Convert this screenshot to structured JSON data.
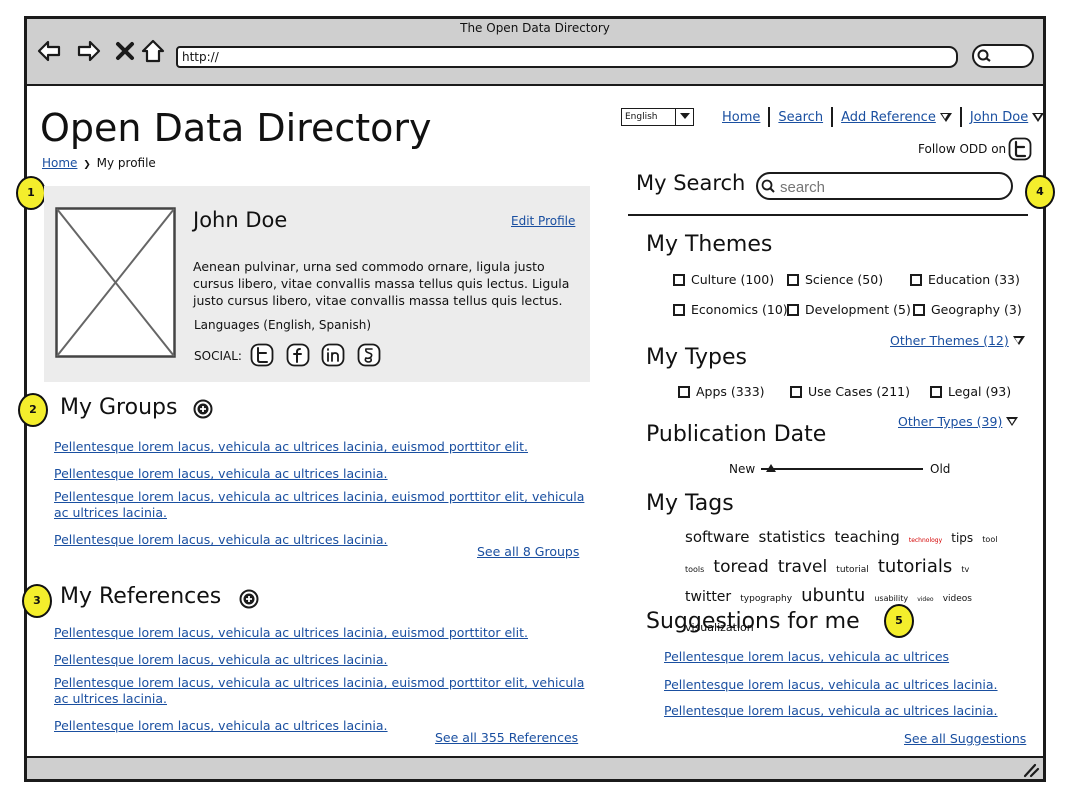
{
  "window": {
    "title": "The Open Data Directory",
    "url": "http://"
  },
  "header": {
    "title": "Open Data Directory",
    "breadcrumb": {
      "home": "Home",
      "separator": "❯",
      "current": "My profile"
    }
  },
  "top_nav": {
    "language": "English",
    "home": "Home",
    "search": "Search",
    "add_reference": "Add Reference",
    "user": "John Doe",
    "follow_label": "Follow ODD on"
  },
  "markers": [
    "1",
    "2",
    "3",
    "4",
    "5"
  ],
  "profile": {
    "name": "John Doe",
    "edit_label": "Edit Profile",
    "bio": "Aenean pulvinar, urna sed commodo ornare, ligula justo cursus libero, vitae convallis massa tellus quis lectus. Ligula justo cursus libero, vitae convallis massa tellus quis lectus.",
    "languages": "Languages (English, Spanish)",
    "social_label": "SOCIAL:",
    "social_icons": [
      "twitter-icon",
      "facebook-icon",
      "linkedin-icon",
      "google-icon"
    ]
  },
  "groups": {
    "title": "My Groups",
    "items": [
      "Pellentesque lorem lacus, vehicula ac ultrices lacinia, euismod porttitor elit.",
      "Pellentesque lorem lacus, vehicula ac ultrices lacinia.",
      "Pellentesque lorem lacus, vehicula ac ultrices lacinia, euismod porttitor elit, vehicula ac ultrices lacinia.",
      "Pellentesque lorem lacus, vehicula ac ultrices lacinia."
    ],
    "see_all": "See all 8 Groups"
  },
  "references": {
    "title": "My References",
    "items": [
      "Pellentesque lorem lacus, vehicula ac ultrices lacinia, euismod porttitor elit.",
      "Pellentesque lorem lacus, vehicula ac ultrices lacinia.",
      "Pellentesque lorem lacus, vehicula ac ultrices lacinia, euismod porttitor elit, vehicula ac ultrices lacinia.",
      "Pellentesque lorem lacus, vehicula ac ultrices lacinia."
    ],
    "see_all": "See all 355 References"
  },
  "search": {
    "label": "My Search",
    "placeholder": "search"
  },
  "themes": {
    "title": "My Themes",
    "items": [
      "Culture (100)",
      "Science (50)",
      "Education (33)",
      "Economics (10)",
      "Development (5)",
      "Geography (3)"
    ],
    "other": "Other Themes (12)"
  },
  "types": {
    "title": "My Types",
    "items": [
      "Apps (333)",
      "Use Cases (211)",
      "Legal (93)"
    ],
    "other": "Other Types (39)"
  },
  "publication_date": {
    "title": "Publication Date",
    "min_label": "New",
    "max_label": "Old",
    "value_fraction": 0.06
  },
  "tags": {
    "title": "My Tags",
    "items": [
      {
        "text": "software",
        "size": 15
      },
      {
        "text": "statistics",
        "size": 15
      },
      {
        "text": "teaching",
        "size": 15
      },
      {
        "text": "technology",
        "size": 6,
        "color": "#d40000"
      },
      {
        "text": "tips",
        "size": 12
      },
      {
        "text": "tool",
        "size": 8
      },
      {
        "text": "tools",
        "size": 8
      },
      {
        "text": "toread",
        "size": 17
      },
      {
        "text": "travel",
        "size": 17
      },
      {
        "text": "tutorial",
        "size": 9
      },
      {
        "text": "tutorials",
        "size": 18
      },
      {
        "text": "tv",
        "size": 8
      },
      {
        "text": "twitter",
        "size": 14
      },
      {
        "text": "typography",
        "size": 9
      },
      {
        "text": "ubuntu",
        "size": 18
      },
      {
        "text": "usability",
        "size": 8
      },
      {
        "text": "video",
        "size": 6
      },
      {
        "text": "videos",
        "size": 9
      },
      {
        "text": "visualization",
        "size": 11
      }
    ]
  },
  "suggestions": {
    "title": "Suggestions for me",
    "items": [
      "Pellentesque lorem lacus, vehicula ac ultrices",
      "Pellentesque lorem lacus, vehicula ac ultrices lacinia.",
      "Pellentesque lorem lacus, vehicula ac ultrices lacinia."
    ],
    "see_all": "See all Suggestions"
  },
  "theme_colors": {
    "link": "#1a4fa0",
    "chrome": "#cfcfcf",
    "card": "#ececec",
    "marker": "#f4ee2c",
    "tag_highlight": "#d40000"
  }
}
